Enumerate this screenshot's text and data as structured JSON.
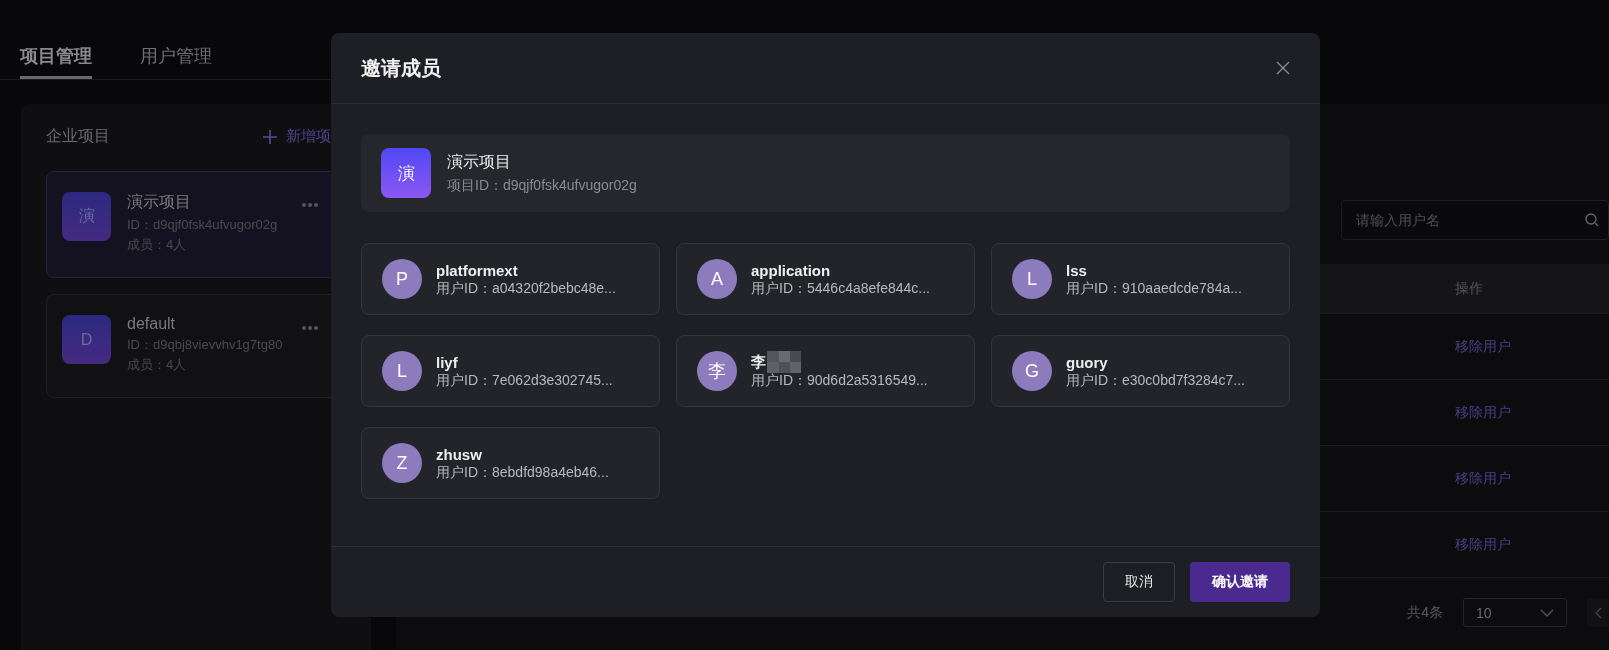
{
  "tabs": [
    {
      "label": "项目管理",
      "selected": true
    },
    {
      "label": "用户管理",
      "selected": false
    }
  ],
  "sidebar": {
    "title": "企业项目",
    "add_label": "新增项",
    "projects": [
      {
        "icon": "演",
        "name": "演示项目",
        "id": "ID：d9qjf0fsk4ufvugor02g",
        "members": "成员：4人",
        "selected": true
      },
      {
        "icon": "D",
        "name": "default",
        "id": "ID：d9qbj8vievvhv1g7tg80",
        "members": "成员：4人",
        "selected": false
      }
    ]
  },
  "search": {
    "placeholder": "请输入用户名"
  },
  "table": {
    "columns": [
      "操作"
    ],
    "rows": [
      {
        "action": "移除用户"
      },
      {
        "action": "移除用户"
      },
      {
        "action": "移除用户"
      },
      {
        "action": "移除用户"
      }
    ]
  },
  "pagination": {
    "total": "共4条",
    "page_size": "10"
  },
  "dialog": {
    "title": "邀请成员",
    "project": {
      "icon": "演",
      "name": "演示项目",
      "id": "项目ID：d9qjf0fsk4ufvugor02g"
    },
    "users": [
      {
        "initial": "P",
        "name": "platformext",
        "id": "用户ID：a04320f2bebc48e...",
        "redacted": false
      },
      {
        "initial": "A",
        "name": "application",
        "id": "用户ID：5446c4a8efe844c...",
        "redacted": false
      },
      {
        "initial": "L",
        "name": "lss",
        "id": "用户ID：910aaedcde784a...",
        "redacted": false
      },
      {
        "initial": "L",
        "name": "liyf",
        "id": "用户ID：7e062d3e302745...",
        "redacted": false
      },
      {
        "initial": "李",
        "name": "李",
        "id": "用户ID：90d6d2a5316549...",
        "redacted": true
      },
      {
        "initial": "G",
        "name": "guory",
        "id": "用户ID：e30c0bd7f3284c7...",
        "redacted": false
      },
      {
        "initial": "Z",
        "name": "zhusw",
        "id": "用户ID：8ebdfd98a4eb46...",
        "redacted": false
      }
    ],
    "buttons": {
      "cancel": "取消",
      "confirm": "确认邀请"
    }
  }
}
